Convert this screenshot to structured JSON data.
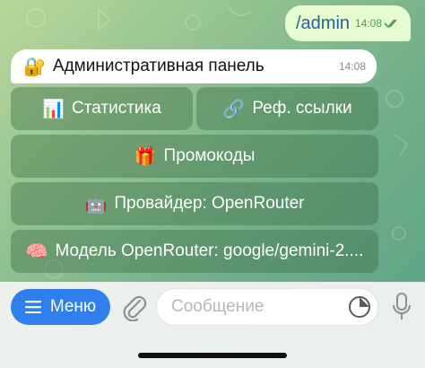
{
  "outgoing": {
    "text": "/admin",
    "time": "14:08"
  },
  "incoming": {
    "emoji": "🔐",
    "title": "Административная панель",
    "time": "14:08"
  },
  "keyboard": {
    "stats": {
      "emoji": "📊",
      "label": "Статистика"
    },
    "refs": {
      "emoji": "🔗",
      "label": "Реф. ссылки"
    },
    "promo": {
      "emoji": "🎁",
      "label": "Промокоды"
    },
    "provider": {
      "emoji": "🤖",
      "label": "Провайдер: OpenRouter"
    },
    "model": {
      "emoji": "🧠",
      "label": "Модель OpenRouter: google/gemini-2...."
    }
  },
  "composer": {
    "menu_label": "Меню",
    "input_placeholder": "Сообщение"
  },
  "colors": {
    "accent": "#2f80ed",
    "outgoing_bubble": "#e6fbcf",
    "outgoing_text": "#2b5f9e",
    "check": "#4f9a56"
  }
}
